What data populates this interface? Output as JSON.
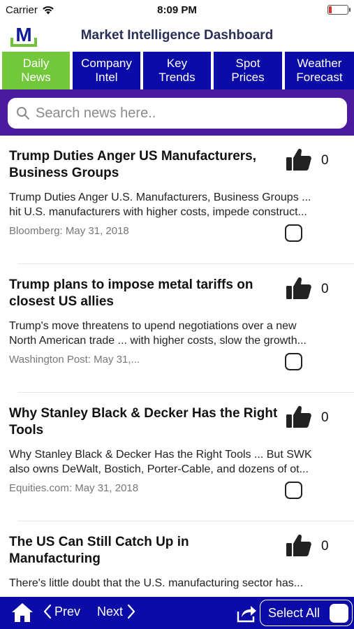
{
  "status_bar": {
    "carrier": "Carrier",
    "time": "8:09 PM",
    "battery_level": 0.15,
    "battery_color": "#e52b2b"
  },
  "header": {
    "logo_letter": "M",
    "title": "Market Intelligence Dashboard"
  },
  "tabs": [
    {
      "label": "Daily\nNews",
      "active": true
    },
    {
      "label": "Company\nIntel",
      "active": false
    },
    {
      "label": "Key\nTrends",
      "active": false
    },
    {
      "label": "Spot\nPrices",
      "active": false
    },
    {
      "label": "Weather\nForecast",
      "active": false
    }
  ],
  "search": {
    "placeholder": "Search news here..",
    "value": ""
  },
  "news": [
    {
      "title": "Trump Duties Anger US Manufacturers, Business Groups",
      "desc_line1": "Trump Duties Anger U.S. Manufacturers, Business Groups ...",
      "desc_line2": "hit U.S. manufacturers with higher costs, impede construct...",
      "source": "Bloomberg: May 31, 2018",
      "likes": "0",
      "checked": false
    },
    {
      "title": "Trump plans to impose metal tariffs on closest US allies",
      "desc_line1": "Trump's move threatens to upend negotiations over a new",
      "desc_line2": "North American trade ... with higher costs, slow the growth...",
      "source": "Washington Post: May 31,...",
      "likes": "0",
      "checked": false
    },
    {
      "title": "Why Stanley Black & Decker Has the Right Tools",
      "desc_line1": "Why Stanley Black & Decker Has the Right Tools ... But SWK",
      "desc_line2": "also owns DeWalt, Bostich, Porter-Cable, and dozens of ot...",
      "source": "Equities.com: May 31, 2018",
      "likes": "0",
      "checked": false
    },
    {
      "title": "The US Can Still Catch Up in Manufacturing",
      "desc_line1": "There's little doubt that the U.S. manufacturing sector has...",
      "desc_line2": "",
      "source": "",
      "likes": "0",
      "checked": false
    }
  ],
  "toolbar": {
    "prev_label": "Prev",
    "next_label": "Next",
    "select_all_label": "Select All"
  },
  "colors": {
    "nav_blue": "#0b0ba8",
    "active_tab_green": "#73c73a",
    "search_band_purple": "#4b1aa0",
    "title_navy": "#2a2f55"
  },
  "icons": [
    "wifi-icon",
    "battery-icon",
    "logo-icon",
    "search-icon",
    "thumbs-up-icon",
    "home-icon",
    "chevron-left-icon",
    "chevron-right-icon",
    "share-icon"
  ]
}
